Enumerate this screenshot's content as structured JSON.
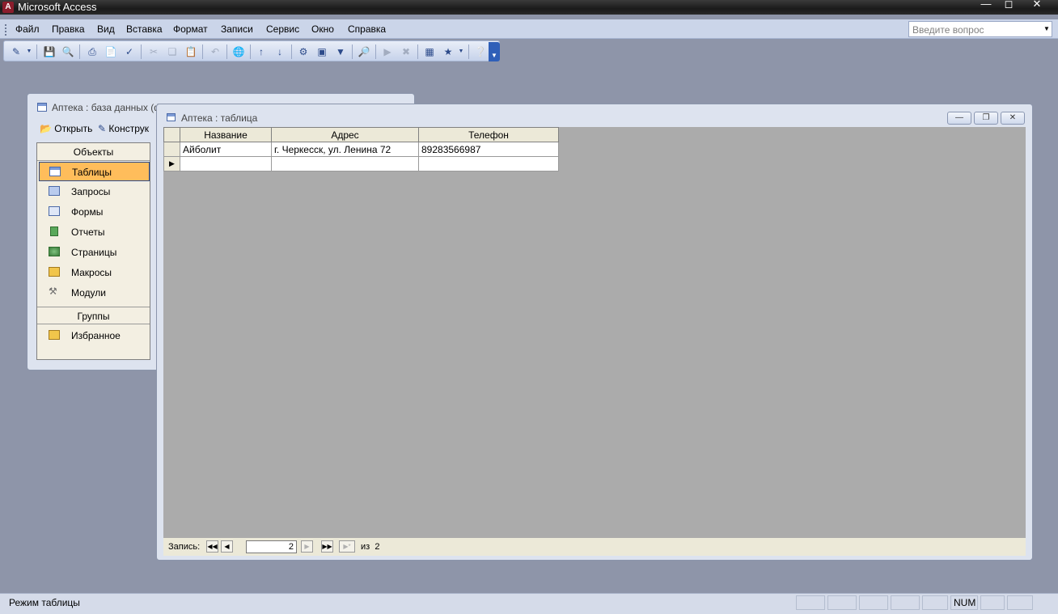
{
  "app": {
    "title": "Microsoft Access"
  },
  "menu": {
    "items": [
      "Файл",
      "Правка",
      "Вид",
      "Вставка",
      "Формат",
      "Записи",
      "Сервис",
      "Окно",
      "Справка"
    ],
    "help_placeholder": "Введите вопрос"
  },
  "db_window": {
    "title": "Аптека : база данных (ф",
    "open_label": "Открыть",
    "design_label": "Конструк",
    "objects_header": "Объекты",
    "objects": [
      "Таблицы",
      "Запросы",
      "Формы",
      "Отчеты",
      "Страницы",
      "Макросы",
      "Модули"
    ],
    "selected_object": "Таблицы",
    "groups_header": "Группы",
    "groups": [
      "Избранное"
    ]
  },
  "table_window": {
    "title": "Аптека : таблица",
    "columns": [
      "Название",
      "Адрес",
      "Телефон"
    ],
    "rows": [
      [
        "Айболит",
        "г. Черкесск, ул. Ленина 72",
        "89283566987"
      ]
    ],
    "nav": {
      "label": "Запись:",
      "current": "2",
      "of_label": "из",
      "total": "2"
    }
  },
  "status": {
    "mode": "Режим таблицы",
    "num": "NUM"
  }
}
